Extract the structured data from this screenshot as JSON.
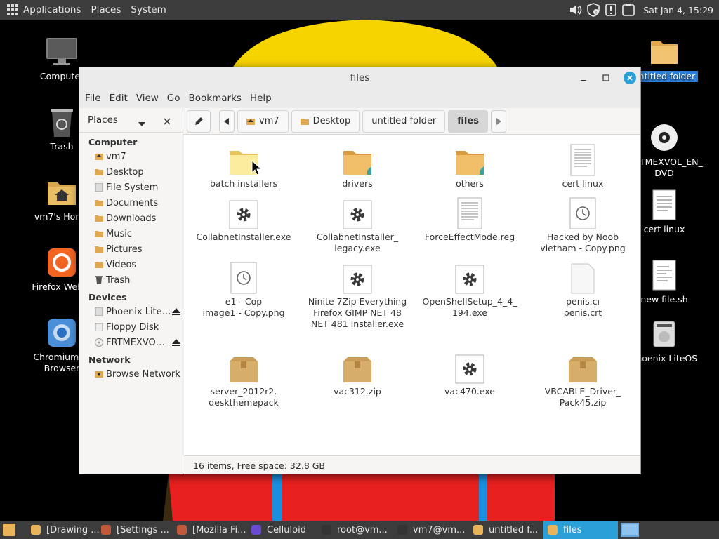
{
  "top_panel": {
    "applications": "Applications",
    "places": "Places",
    "system": "System",
    "clock": "Sat Jan  4, 15:29"
  },
  "desktop_icons": {
    "computer": "Computer",
    "trash": "Trash",
    "home": "vm7's Home",
    "firefox": "Firefox Web B",
    "chromium_line1": "Chromium W",
    "chromium_line2": "Browser",
    "untitled_folder": "untitled folder",
    "frtmexvol_line1": "FRTMEXVOL_EN_",
    "frtmexvol_line2": "DVD",
    "cert_linux": "cert linux",
    "new_file": "new file.sh",
    "phoenix": "Phoenix LiteOS"
  },
  "window": {
    "title": "files"
  },
  "menubar": {
    "file": "File",
    "edit": "Edit",
    "view": "View",
    "go": "Go",
    "bookmarks": "Bookmarks",
    "help": "Help"
  },
  "sidebar": {
    "header": "Places",
    "computer_section": "Computer",
    "devices_section": "Devices",
    "network_section": "Network",
    "items": [
      "vm7",
      "Desktop",
      "File System",
      "Documents",
      "Downloads",
      "Music",
      "Pictures",
      "Videos",
      "Trash"
    ],
    "devices": [
      "Phoenix Lite…",
      "Floppy Disk",
      "FRTMEXVO…"
    ],
    "network": [
      "Browse Network"
    ]
  },
  "breadcrumbs": [
    "vm7",
    "Desktop",
    "untitled folder",
    "files"
  ],
  "files": [
    {
      "line1": "batch installers",
      "line2": "",
      "line3": "",
      "type": "folder-light"
    },
    {
      "line1": "drivers",
      "line2": "",
      "line3": "",
      "type": "folder"
    },
    {
      "line1": "others",
      "line2": "",
      "line3": "",
      "type": "folder"
    },
    {
      "line1": "cert linux",
      "line2": "",
      "line3": "",
      "type": "text"
    },
    {
      "line1": "CollabnetInstaller.exe",
      "line2": "",
      "line3": "",
      "type": "exe"
    },
    {
      "line1": "CollabnetInstaller_",
      "line2": "legacy.exe",
      "line3": "",
      "type": "exe"
    },
    {
      "line1": "ForceEffectMode.reg",
      "line2": "",
      "line3": "",
      "type": "text"
    },
    {
      "line1": "Hacked by Noob",
      "line2": "vietnam - Copy.png",
      "line3": "",
      "type": "image"
    },
    {
      "line1": "e1 - Cop",
      "line2": "image1 - Copy.png",
      "line3": "",
      "type": "image"
    },
    {
      "line1": "Ninite 7Zip Everything",
      "line2": "Firefox GIMP NET 48",
      "line3": "NET 481 Installer.exe",
      "type": "exe"
    },
    {
      "line1": "OpenShellSetup_4_4_",
      "line2": "194.exe",
      "line3": "",
      "type": "exe"
    },
    {
      "line1": "penis.cı",
      "line2": "penis.crt",
      "line3": "",
      "type": "blank"
    },
    {
      "line1": "server_2012r2.",
      "line2": "deskthemepack",
      "line3": "",
      "type": "package"
    },
    {
      "line1": "vac312.zip",
      "line2": "",
      "line3": "",
      "type": "package"
    },
    {
      "line1": "vac470.exe",
      "line2": "",
      "line3": "",
      "type": "exe"
    },
    {
      "line1": "VBCABLE_Driver_",
      "line2": "Pack45.zip",
      "line3": "",
      "type": "package"
    }
  ],
  "status": "16 items, Free space: 32.8 GB",
  "taskbar": [
    "[Drawing ...",
    "[Settings ...",
    "[Mozilla Fi...",
    "Celluloid",
    "root@vm...",
    "vm7@vm...",
    "untitled f...",
    "files"
  ]
}
